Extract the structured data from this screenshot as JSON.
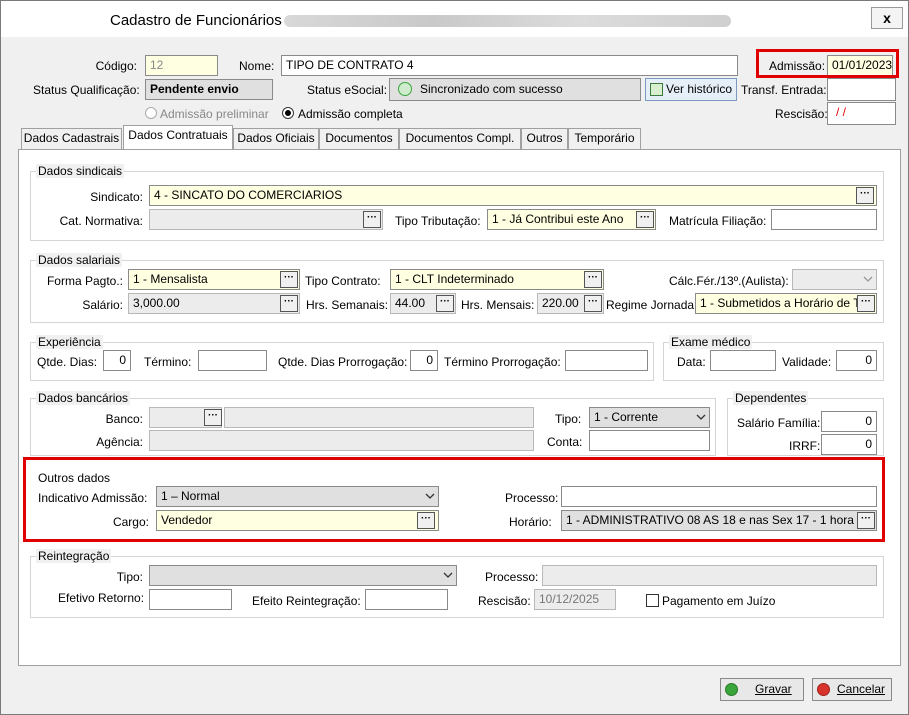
{
  "window": {
    "title": "Cadastro de Funcionários",
    "close": "x"
  },
  "header": {
    "codigo_label": "Código:",
    "codigo": "12",
    "nome_label": "Nome:",
    "nome": "TIPO DE CONTRATO 4",
    "admissao_label": "Admissão:",
    "admissao": "01/01/2023",
    "status_qual_label": "Status Qualificação:",
    "status_qual": "Pendente envio",
    "status_esocial_label": "Status eSocial:",
    "status_esocial": "Sincronizado com sucesso",
    "ver_historico": "Ver histórico",
    "transf_label": "Transf. Entrada:",
    "rescisao_label": "Rescisão:",
    "rescisao": "/ /",
    "radio_preliminar": "Admissão preliminar",
    "radio_completa": "Admissão completa"
  },
  "tabs": [
    "Dados Cadastrais",
    "Dados Contratuais",
    "Dados Oficiais",
    "Documentos",
    "Documentos Compl.",
    "Outros",
    "Temporário"
  ],
  "sindicais": {
    "title": "Dados sindicais",
    "sindicato_label": "Sindicato:",
    "sindicato": "4 - SINCATO DO COMERCIARIOS",
    "cat_label": "Cat. Normativa:",
    "tipo_trib_label": "Tipo Tributação:",
    "tipo_trib": "1 - Já Contribui este Ano",
    "matricula_label": "Matrícula Filiação:"
  },
  "salariais": {
    "title": "Dados salariais",
    "forma_label": "Forma Pagto.:",
    "forma": "1 -  Mensalista",
    "tipo_contrato_label": "Tipo Contrato:",
    "tipo_contrato": "1 - CLT Indeterminado",
    "calc_label": "Cálc.Fér./13º.(Aulista):",
    "salario_label": "Salário:",
    "salario": "3,000.00",
    "hrs_sem_label": "Hrs. Semanais:",
    "hrs_sem": "44.00",
    "hrs_mens_label": "Hrs. Mensais:",
    "hrs_mens": "220.00",
    "regime_label": "Regime Jornada:",
    "regime": "1 - Submetidos a Horário de T"
  },
  "experiencia": {
    "title": "Experiência",
    "qtde_label": "Qtde. Dias:",
    "qtde": "0",
    "termino_label": "Término:",
    "qtde_prorr_label": "Qtde. Dias Prorrogação:",
    "qtde_prorr": "0",
    "termino_prorr_label": "Término Prorrogação:"
  },
  "exame": {
    "title": "Exame médico",
    "data_label": "Data:",
    "validade_label": "Validade:",
    "validade": "0"
  },
  "bancarios": {
    "title": "Dados bancários",
    "banco_label": "Banco:",
    "agencia_label": "Agência:",
    "tipo_label": "Tipo:",
    "tipo": "1 - Corrente",
    "conta_label": "Conta:"
  },
  "dependentes": {
    "title": "Dependentes",
    "sal_fam_label": "Salário Família:",
    "sal_fam": "0",
    "irrf_label": "IRRF:",
    "irrf": "0"
  },
  "outros": {
    "title": "Outros dados",
    "indicativo_label": "Indicativo Admissão:",
    "indicativo": "1 – Normal",
    "processo_label": "Processo:",
    "cargo_label": "Cargo:",
    "cargo": "Vendedor",
    "horario_label": "Horário:",
    "horario": "1 - ADMINISTRATIVO 08 AS 18 e nas Sex 17 - 1 hora"
  },
  "reintegracao": {
    "title": "Reintegração",
    "tipo_label": "Tipo:",
    "processo_label": "Processo:",
    "efetivo_label": "Efetivo Retorno:",
    "efeito_label": "Efeito Reintegração:",
    "rescisao_label": "Rescisão:",
    "rescisao": "10/12/2025",
    "pagamento_label": "Pagamento em Juízo"
  },
  "buttons": {
    "gravar": "Gravar",
    "cancelar": "Cancelar"
  },
  "colors": {
    "highlight": "#e00000",
    "field_yellow": "#ffffe1",
    "ok_green": "#3aa53a",
    "cancel_red": "#d9342b"
  }
}
